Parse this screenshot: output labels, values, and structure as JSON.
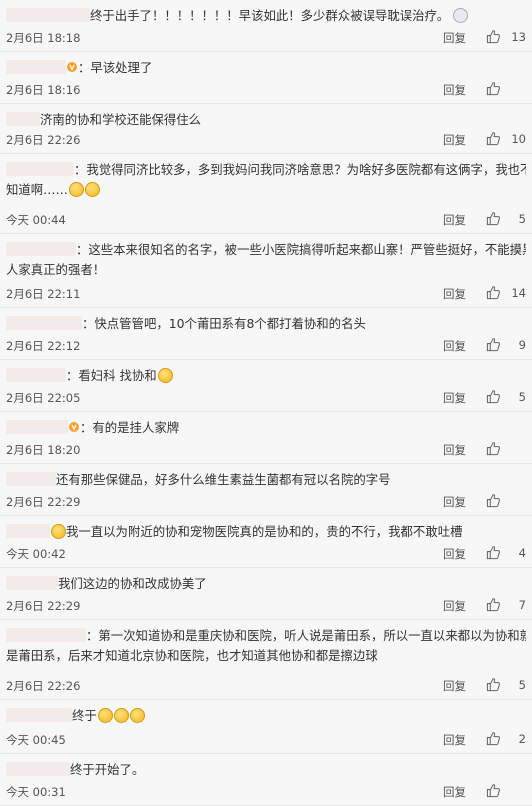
{
  "comments": [
    {
      "id": 1,
      "text": "终于出手了！！！！！！！早该如此！多少群众被误导耽误治疗。",
      "line2": "",
      "time": "2月6日 18:18",
      "reply": "回复",
      "likes": "13",
      "username_blur_width": 84,
      "emoji_after": "",
      "badge": "avatar-icon"
    },
    {
      "id": 2,
      "text": "：早该处理了",
      "line2": "",
      "time": "2月6日 18:16",
      "reply": "回复",
      "likes": "",
      "username_blur_width": 60,
      "badge": "fire-badge-icon"
    },
    {
      "id": 3,
      "text": "济南的协和学校还能保得住么",
      "line2": "",
      "time": "2月6日 22:26",
      "reply": "回复",
      "likes": "10",
      "username_blur_width": 34
    },
    {
      "id": 4,
      "text": "：我觉得同济比较多，多到我妈问我同济啥意思？为啥好多医院都有这俩字，我也不",
      "line2": "知道啊……",
      "time": "今天 00:44",
      "reply": "回复",
      "likes": "5",
      "username_blur_width": 68,
      "line2_emojis": 2
    },
    {
      "id": 5,
      "text": "：这些本来很知名的名字，被一些小医院搞得听起来都山寨！严管些挺好，不能摸黑",
      "line2": "人家真正的强者！",
      "time": "2月6日 22:11",
      "reply": "回复",
      "likes": "14",
      "username_blur_width": 70
    },
    {
      "id": 6,
      "text": "：快点管管吧，10个莆田系有8个都打着协和的名头",
      "line2": "",
      "time": "2月6日 22:12",
      "reply": "回复",
      "likes": "9",
      "username_blur_width": 76
    },
    {
      "id": 7,
      "text": "：看妇科 找协和",
      "line2": "",
      "time": "2月6日 22:05",
      "reply": "回复",
      "likes": "5",
      "username_blur_width": 60,
      "emoji_after_count": 1
    },
    {
      "id": 8,
      "text": "：有的是挂人家牌",
      "line2": "",
      "time": "2月6日 18:20",
      "reply": "回复",
      "likes": "",
      "username_blur_width": 62,
      "badge": "vip-badge-icon"
    },
    {
      "id": 9,
      "text": "还有那些保健品，好多什么维生素益生菌都有冠以名院的字号",
      "line2": "",
      "time": "2月6日 22:29",
      "reply": "回复",
      "likes": "",
      "username_blur_width": 50
    },
    {
      "id": 10,
      "text": "我一直以为附近的协和宠物医院真的是协和的，贵的不行，我都不敢吐槽",
      "line2": "",
      "time": "今天 00:42",
      "reply": "回复",
      "likes": "4",
      "username_blur_width": 44,
      "emoji_before": true
    },
    {
      "id": 11,
      "text": "我们这边的协和改成协美了",
      "line2": "",
      "time": "2月6日 22:29",
      "reply": "回复",
      "likes": "7",
      "username_blur_width": 52
    },
    {
      "id": 12,
      "text": "：第一次知道协和是重庆协和医院，听人说是莆田系，所以一直以来都以为协和就",
      "line2": "是莆田系，后来才知道北京协和医院，也才知道其他协和都是擦边球",
      "time": "2月6日 22:26",
      "reply": "回复",
      "likes": "5",
      "username_blur_width": 80
    },
    {
      "id": 13,
      "text": "终于",
      "line2": "",
      "time": "今天 00:45",
      "reply": "回复",
      "likes": "2",
      "username_blur_width": 66,
      "emoji_after_count": 3
    },
    {
      "id": 14,
      "text": "终于开始了。",
      "line2": "",
      "time": "今天 00:31",
      "reply": "回复",
      "likes": "",
      "username_blur_width": 64
    }
  ]
}
